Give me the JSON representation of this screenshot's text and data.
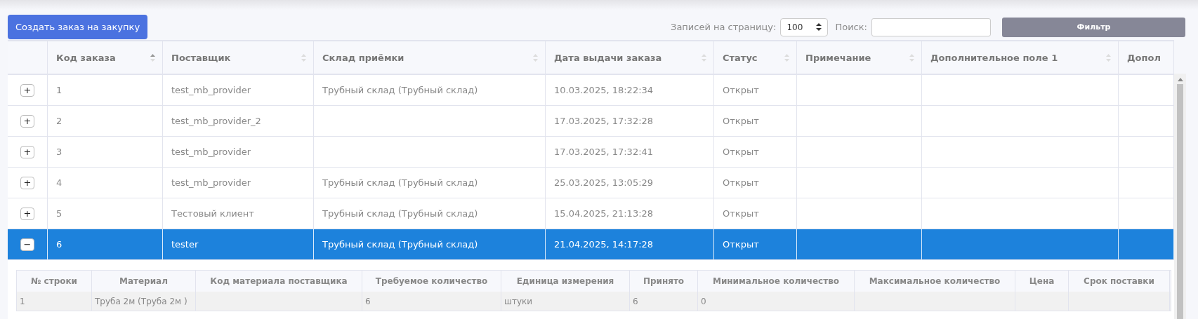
{
  "create_button": "Создать заказ на закупку",
  "page_size": {
    "label": "Записей на страницу:",
    "value": "100"
  },
  "search": {
    "label": "Поиск:"
  },
  "filter_button": "Фильтр",
  "table": {
    "columns": [
      {
        "label": "Код заказа",
        "sorted": true
      },
      {
        "label": "Поставщик",
        "sorted": false
      },
      {
        "label": "Склад приёмки",
        "sorted": false
      },
      {
        "label": "Дата выдачи заказа",
        "sorted": false
      },
      {
        "label": "Статус",
        "sorted": false
      },
      {
        "label": "Примечание",
        "sorted": false
      },
      {
        "label": "Дополнительное поле 1",
        "sorted": false
      },
      {
        "label": "Допол"
      }
    ],
    "rows": [
      {
        "toggle": "+",
        "selected": false,
        "cells": [
          "1",
          "test_mb_provider",
          "Трубный склад (Трубный склад)",
          "10.03.2025, 18:22:34",
          "Открыт",
          "",
          "",
          ""
        ]
      },
      {
        "toggle": "+",
        "selected": false,
        "cells": [
          "2",
          "test_mb_provider_2",
          "",
          "17.03.2025, 17:32:28",
          "Открыт",
          "",
          "",
          ""
        ]
      },
      {
        "toggle": "+",
        "selected": false,
        "cells": [
          "3",
          "test_mb_provider",
          "",
          "17.03.2025, 17:32:41",
          "Открыт",
          "",
          "",
          ""
        ]
      },
      {
        "toggle": "+",
        "selected": false,
        "cells": [
          "4",
          "test_mb_provider",
          "Трубный склад (Трубный склад)",
          "25.03.2025, 13:05:29",
          "Открыт",
          "",
          "",
          ""
        ]
      },
      {
        "toggle": "+",
        "selected": false,
        "cells": [
          "5",
          "Тестовый клиент",
          "Трубный склад (Трубный склад)",
          "15.04.2025, 21:13:28",
          "Открыт",
          "",
          "",
          ""
        ]
      },
      {
        "toggle": "−",
        "selected": true,
        "cells": [
          "6",
          "tester",
          "Трубный склад (Трубный склад)",
          "21.04.2025, 14:17:28",
          "Открыт",
          "",
          "",
          ""
        ],
        "details": {
          "columns": [
            "№ строки",
            "Материал",
            "Код материала поставщика",
            "Требуемое количество",
            "Единица измерения",
            "Принято",
            "Минимальное количество",
            "Максимальное количество",
            "Цена",
            "Срок поставки"
          ],
          "rows": [
            [
              "1",
              "Труба 2м (Труба 2м )",
              "",
              "6",
              "штуки",
              "6",
              "0",
              "",
              "",
              ""
            ]
          ]
        }
      }
    ]
  }
}
